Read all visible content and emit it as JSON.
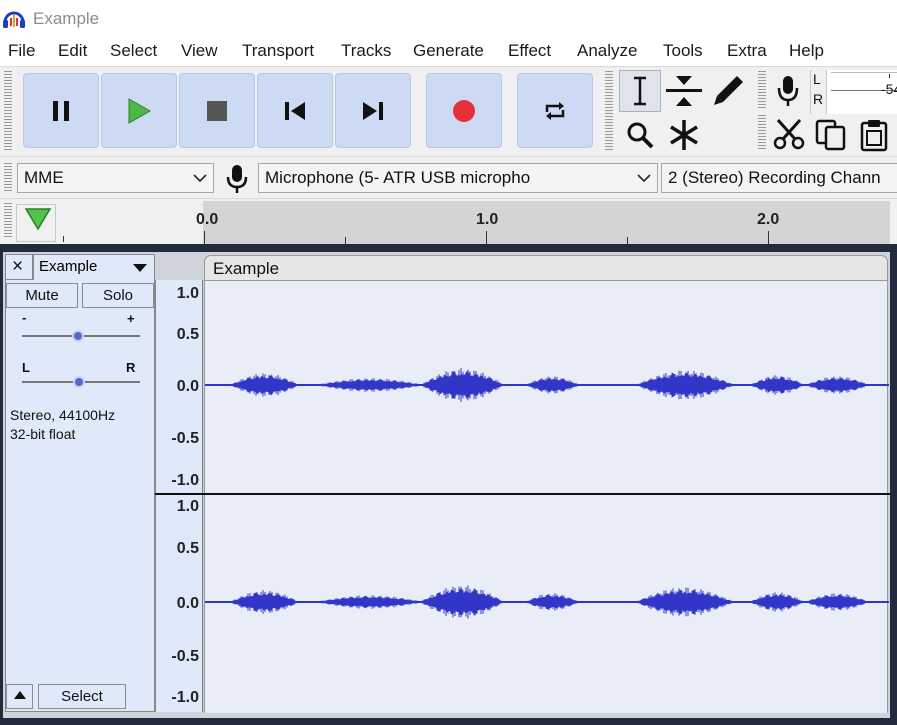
{
  "window": {
    "title": "Example"
  },
  "menu": [
    "File",
    "Edit",
    "Select",
    "View",
    "Transport",
    "Tracks",
    "Generate",
    "Effect",
    "Analyze",
    "Tools",
    "Extra",
    "Help"
  ],
  "meter": {
    "left_label": "L",
    "right_label": "R",
    "value_text": "-54"
  },
  "devices": {
    "host": "MME",
    "recording_device": "Microphone (5- ATR USB micropho",
    "channels": "2 (Stereo) Recording Chann"
  },
  "ruler": {
    "labels": [
      "0.0",
      "1.0",
      "2.0"
    ]
  },
  "track": {
    "name": "Example",
    "mute_label": "Mute",
    "solo_label": "Solo",
    "gain_minus": "-",
    "gain_plus": "+",
    "pan_left": "L",
    "pan_right": "R",
    "info_line1": "Stereo, 44100Hz",
    "info_line2": "32-bit float",
    "select_label": "Select",
    "close_label": "×"
  },
  "clip": {
    "name": "Example"
  },
  "vertical_scale": [
    "1.0",
    "0.5",
    "0.0",
    "-0.5",
    "-1.0"
  ],
  "colors": {
    "waveform": "#3236c8",
    "button_blue": "#cddaf3",
    "record_red": "#e53238",
    "play_green": "#3cb043"
  }
}
